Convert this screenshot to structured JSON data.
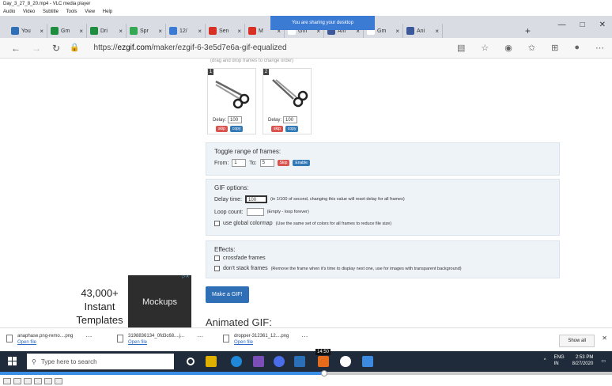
{
  "vlc": {
    "title": "Day_3_27_8_20.mp4 - VLC media player",
    "menu": [
      "Audio",
      "Video",
      "Subtitle",
      "Tools",
      "View",
      "Help"
    ]
  },
  "browser": {
    "tabs": [
      {
        "label": "You",
        "color": "#2f6fb6"
      },
      {
        "label": "Gm",
        "color": "#1e8e3e"
      },
      {
        "label": "Dri",
        "color": "#1e8e3e"
      },
      {
        "label": "Spr",
        "color": "#34a853"
      },
      {
        "label": "12/",
        "color": "#3b7bd4"
      },
      {
        "label": "Sen",
        "color": "#d93025"
      },
      {
        "label": "M",
        "color": "#d93025"
      },
      {
        "label": "Gm",
        "color": "#ffffff"
      },
      {
        "label": "Ani",
        "color": "#3b5998"
      },
      {
        "label": "Gm",
        "color": "#ffffff"
      },
      {
        "label": "Ani",
        "color": "#3b5998"
      }
    ],
    "share_banner": "You are sharing your desktop",
    "url_prefix": "https://",
    "url_domain": "ezgif.com",
    "url_path": "/maker/ezgif-6-3e5d7e6a-gif-equalized",
    "window_controls": [
      "—",
      "□",
      "✕"
    ]
  },
  "frames": [
    {
      "num": "1",
      "delay_label": "Delay:",
      "delay": "100",
      "skip": "skip",
      "copy": "copy"
    },
    {
      "num": "2",
      "delay_label": "Delay:",
      "delay": "100",
      "skip": "skip",
      "copy": "copy"
    }
  ],
  "toggle": {
    "title": "Toggle range of frames:",
    "from_label": "From:",
    "from": "1",
    "to_label": "To:",
    "to": "5",
    "skip": "Skip",
    "enable": "Enable"
  },
  "gif_options": {
    "title": "GIF options:",
    "delay_label": "Delay time:",
    "delay_value": "100",
    "delay_hint": "(in 1/100 of second, changing this value will reset delay for all frames)",
    "loop_label": "Loop count:",
    "loop_hint": "(Empty - loop forever)",
    "colormap_label": "use global colormap",
    "colormap_hint": "(Use the same set of colors for all frames to reduce file size)"
  },
  "effects": {
    "title": "Effects:",
    "crossfade": "crossfade frames",
    "dont_stack": "don't stack frames",
    "dont_stack_hint": "(Remove the frame when it's time to display next one, use for images with transparent background)"
  },
  "ad": {
    "line1": "43,000+",
    "line2": "Instant",
    "line3": "Templates",
    "image_label": "Mockups"
  },
  "make_gif": "Make a GIF!",
  "animated_gif_title": "Animated GIF:",
  "downloads": [
    {
      "name": "anaphase.png-remo....png",
      "link": "Open file"
    },
    {
      "name": "3198836134_0fd3c68....j...",
      "link": "Open file"
    },
    {
      "name": "dropper-312361_12....png",
      "link": "Open file"
    }
  ],
  "show_all": "Show all",
  "taskbar": {
    "search_placeholder": "Type here to search",
    "lang": "ENG",
    "region": "IN",
    "time": "2:53 PM",
    "date": "8/27/2020"
  },
  "video_time": "14:50",
  "seek_progress": 0.53
}
